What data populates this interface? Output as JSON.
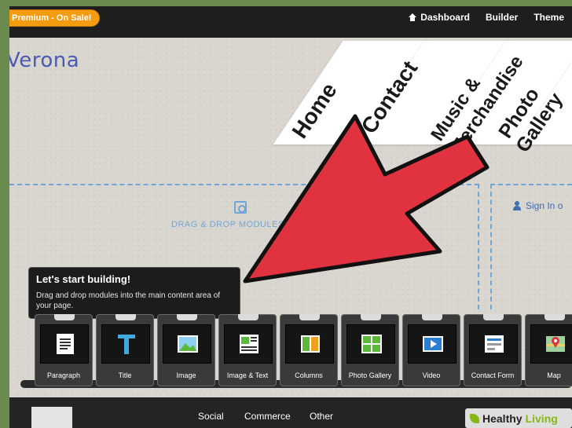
{
  "topbar": {
    "promo": "Premium - On Sale!",
    "nav": [
      {
        "label": "Dashboard",
        "icon": "home-icon"
      },
      {
        "label": "Builder"
      },
      {
        "label": "Theme"
      }
    ]
  },
  "site": {
    "title": "Verona",
    "nav": [
      "Home",
      "Contact",
      "Music &",
      "Merchandise",
      "Photo",
      "Gallery"
    ]
  },
  "dropzone": {
    "label": "DRAG & DROP MODULES"
  },
  "signin": {
    "label": "Sign In o"
  },
  "tooltip": {
    "title": "Let's start building!",
    "body": "Drag and drop modules into the main content area of your page."
  },
  "modules": [
    {
      "label": "Paragraph",
      "icon": "paragraph-icon"
    },
    {
      "label": "Title",
      "icon": "title-icon"
    },
    {
      "label": "Image",
      "icon": "image-icon"
    },
    {
      "label": "Image & Text",
      "icon": "image-text-icon"
    },
    {
      "label": "Columns",
      "icon": "columns-icon"
    },
    {
      "label": "Photo Gallery",
      "icon": "photo-gallery-icon"
    },
    {
      "label": "Video",
      "icon": "video-icon"
    },
    {
      "label": "Contact Form",
      "icon": "contact-form-icon"
    },
    {
      "label": "Map",
      "icon": "map-icon"
    }
  ],
  "tabs": {
    "items": [
      "Social",
      "Commerce",
      "Other"
    ]
  },
  "watermark": {
    "brand_a": "Healthy",
    "brand_b": "Living"
  },
  "colors": {
    "arrow": "#e0323f",
    "accent_blue": "#6fa6d6",
    "promo_orange": "#f39c12",
    "title_blue": "#4a5bb3"
  }
}
